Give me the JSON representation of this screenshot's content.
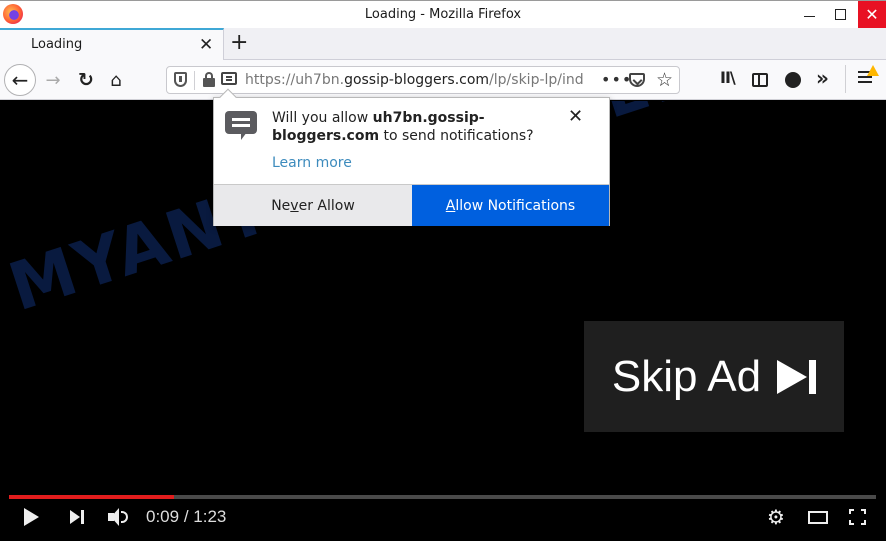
{
  "window": {
    "title": "Loading - Mozilla Firefox",
    "minimize_glyph": "—",
    "close_glyph": "✕"
  },
  "tabs": [
    {
      "label": "Loading",
      "active": true,
      "close_glyph": "✕"
    }
  ],
  "newtab_glyph": "+",
  "nav": {
    "back_glyph": "←",
    "forward_glyph": "→",
    "reload_glyph": "↻",
    "home_glyph": "⌂",
    "url_scheme": "https://",
    "url_subdomain": "uh7bn.",
    "url_host": "gossip-bloggers.com",
    "url_path": "/lp/skip-lp/ind",
    "page_actions_glyph": "•••",
    "bookmark_glyph": "☆",
    "library_glyph": "II\\",
    "overflow_glyph": "»"
  },
  "popup": {
    "message_prefix": "Will you allow ",
    "message_host": "uh7bn.gossip-bloggers.com",
    "message_suffix": " to send notifications?",
    "close_glyph": "✕",
    "learn_more": "Learn more",
    "never_allow": {
      "pre": "Ne",
      "accesskey": "v",
      "post": "er Allow"
    },
    "allow": {
      "pre": "",
      "accesskey": "A",
      "post": "llow Notifications"
    },
    "colors": {
      "allow_bg": "#0060df",
      "never_bg": "#e9e9eb",
      "link": "#3d8bbd"
    }
  },
  "page": {
    "watermark": "MYANTISPYWARE.COM",
    "skip_ad_label": "Skip Ad"
  },
  "player": {
    "current_time": "0:09",
    "duration": "1:23",
    "time_separator": " / ",
    "progress_fraction": 0.19,
    "settings_glyph": "⚙",
    "colors": {
      "progress": "#e21d1d",
      "track": "#4a4a4a"
    }
  }
}
